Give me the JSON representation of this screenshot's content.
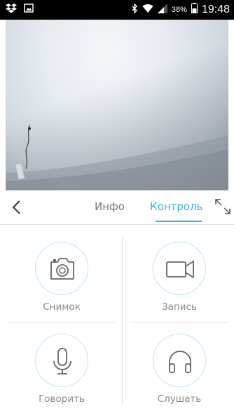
{
  "status_bar": {
    "battery_percent": "38%",
    "time": "19:48",
    "icons": [
      "dropbox-icon",
      "image-notification-icon",
      "bluetooth-icon",
      "wifi-icon",
      "signal-icon",
      "battery-icon"
    ]
  },
  "tabs": {
    "info_label": "Инфо",
    "control_label": "Контроль",
    "active": "control"
  },
  "controls": {
    "snapshot_label": "Снимок",
    "record_label": "Запись",
    "talk_label": "Говорить",
    "listen_label": "Слушать"
  },
  "colors": {
    "accent": "#35b5d8",
    "circle_border": "#bfe6f4",
    "label_gray": "#8a8a8a"
  }
}
